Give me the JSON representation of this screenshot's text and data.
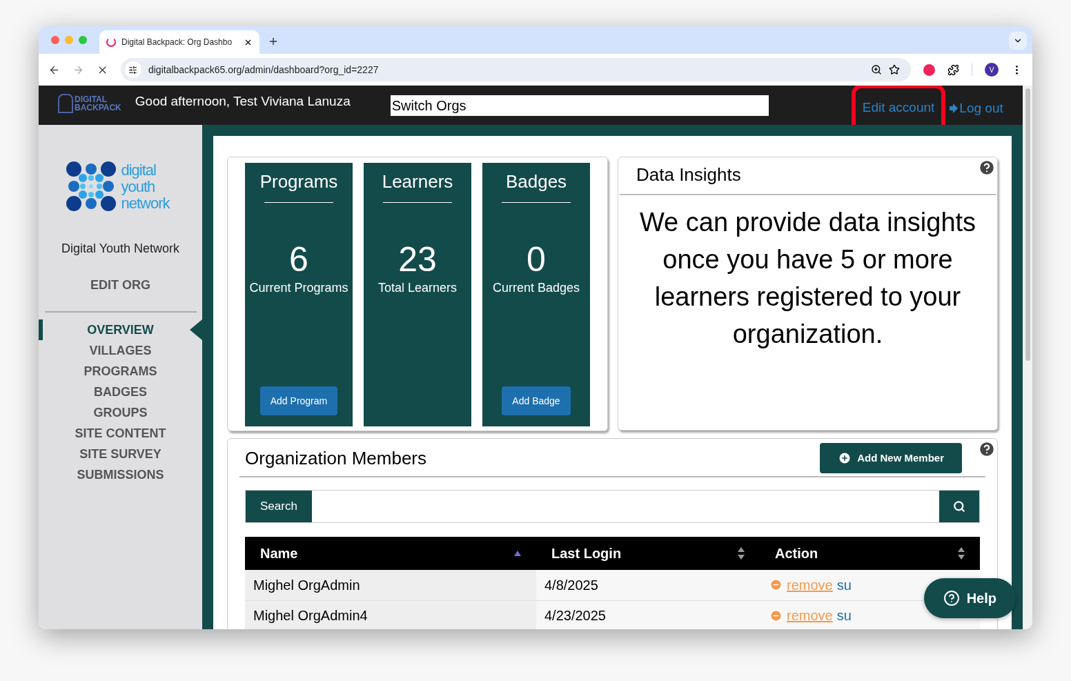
{
  "browser": {
    "tab_title": "Digital Backpack: Org Dashbo",
    "url": "digitalbackpack65.org/admin/dashboard?org_id=2227",
    "profile_initial": "V"
  },
  "header": {
    "logo_lines": [
      "DIGITAL",
      "BACKPACK"
    ],
    "greeting": "Good afternoon, Test Viviana Lanuza",
    "switch_orgs": "Switch Orgs",
    "links": [
      {
        "label": "Edit account",
        "highlighted": true,
        "kind": "plain"
      },
      {
        "label": "Log out",
        "highlighted": false,
        "kind": "arrow"
      }
    ]
  },
  "sidebar": {
    "logo_lines": [
      "digital",
      "youth",
      "network"
    ],
    "org_name": "Digital Youth Network",
    "edit_org": "EDIT ORG",
    "items": [
      {
        "label": "OVERVIEW",
        "selected": true
      },
      {
        "label": "VILLAGES",
        "selected": false
      },
      {
        "label": "PROGRAMS",
        "selected": false
      },
      {
        "label": "BADGES",
        "selected": false
      },
      {
        "label": "GROUPS",
        "selected": false
      },
      {
        "label": "SITE CONTENT",
        "selected": false
      },
      {
        "label": "SITE SURVEY",
        "selected": false
      },
      {
        "label": "SUBMISSIONS",
        "selected": false
      }
    ]
  },
  "stats": [
    {
      "title": "Programs",
      "value": "6",
      "caption": "Current Programs",
      "button": "Add Program"
    },
    {
      "title": "Learners",
      "value": "23",
      "caption": "Total Learners"
    },
    {
      "title": "Badges",
      "value": "0",
      "caption": "Current Badges",
      "button": "Add Badge"
    }
  ],
  "insights": {
    "title": "Data Insights",
    "message": "We can provide data insights once you have 5 or more learners registered to your organization."
  },
  "members": {
    "title": "Organization Members",
    "add_button": "Add New Member",
    "search_label": "Search",
    "columns": [
      {
        "label": "Name",
        "kind": "sorted"
      },
      {
        "label": "Last Login",
        "kind": "sortable"
      },
      {
        "label": "Action",
        "kind": "sortable"
      }
    ],
    "rows": [
      {
        "name": "Mighel OrgAdmin",
        "last_login": "4/8/2025",
        "actions": [
          "remove",
          "su"
        ]
      },
      {
        "name": "Mighel OrgAdmin4",
        "last_login": "4/23/2025",
        "actions": [
          "remove",
          "su"
        ]
      }
    ]
  },
  "help_button": "Help"
}
